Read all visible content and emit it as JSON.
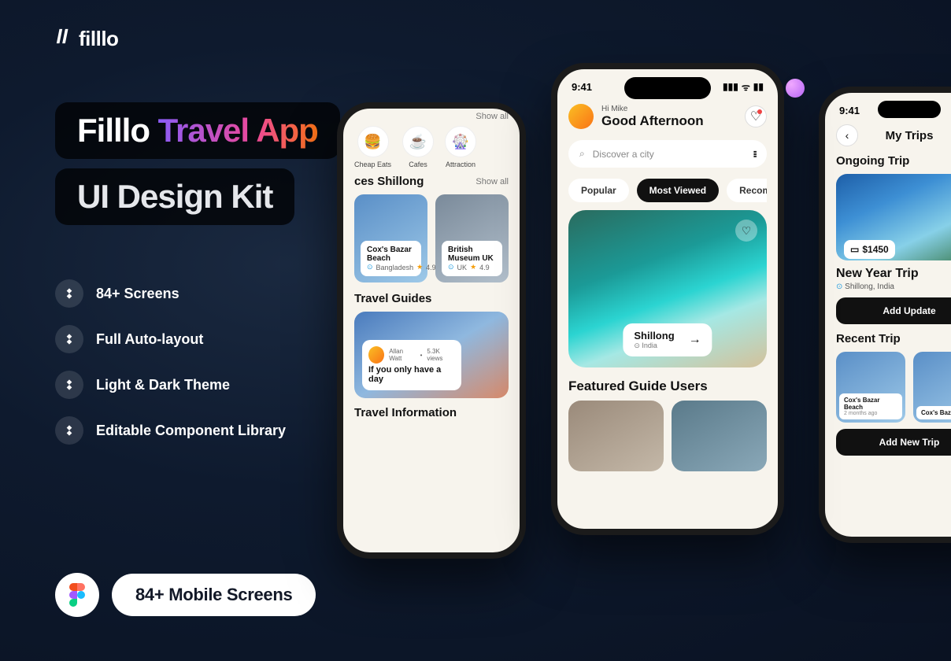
{
  "brand": {
    "name": "filllo"
  },
  "headline": {
    "line1a": "Filllo ",
    "line1b": "Travel App",
    "line2": "UI Design Kit"
  },
  "features": [
    {
      "text": "84+ Screens"
    },
    {
      "text": "Full Auto-layout"
    },
    {
      "text": "Light & Dark Theme"
    },
    {
      "text": "Editable Component Library"
    }
  ],
  "cta": {
    "label": "84+ Mobile Screens"
  },
  "phone_left": {
    "show_all": "Show all",
    "cats": [
      "Cheap Eats",
      "Cafes",
      "Attraction"
    ],
    "places_heading": "ces Shillong",
    "places_show_all": "Show all",
    "card1": {
      "title": "Cox's Bazar Beach",
      "loc": "Bangladesh",
      "rating": "4.9"
    },
    "card2": {
      "title": "British Museum UK",
      "loc": "UK",
      "rating": "4.9"
    },
    "guides_heading": "Travel Guides",
    "guide": {
      "author": "Allan Watt",
      "views": "5.3K views",
      "headline": "If you only have a day"
    },
    "info_heading": "Travel Information"
  },
  "phone_center": {
    "time": "9:41",
    "greeting_small": "Hi Mike",
    "greeting": "Good Afternoon",
    "search_placeholder": "Discover a city",
    "tabs": [
      "Popular",
      "Most Viewed",
      "Recomended"
    ],
    "dest": {
      "name": "Shillong",
      "loc": "India"
    },
    "featured_heading": "Featured Guide Users"
  },
  "phone_right": {
    "time": "9:41",
    "title": "My Trips",
    "ongoing_heading": "Ongoing Trip",
    "price": "$1450",
    "trip_name": "New Year Trip",
    "trip_loc": "Shillong, India",
    "btn_update": "Add Update",
    "recent_heading": "Recent Trip",
    "recent1": {
      "title": "Cox's Bazar Beach",
      "sub": "2 months ago"
    },
    "recent2": {
      "title": "Cox's Baz",
      "sub": ""
    },
    "btn_new": "Add New Trip"
  }
}
